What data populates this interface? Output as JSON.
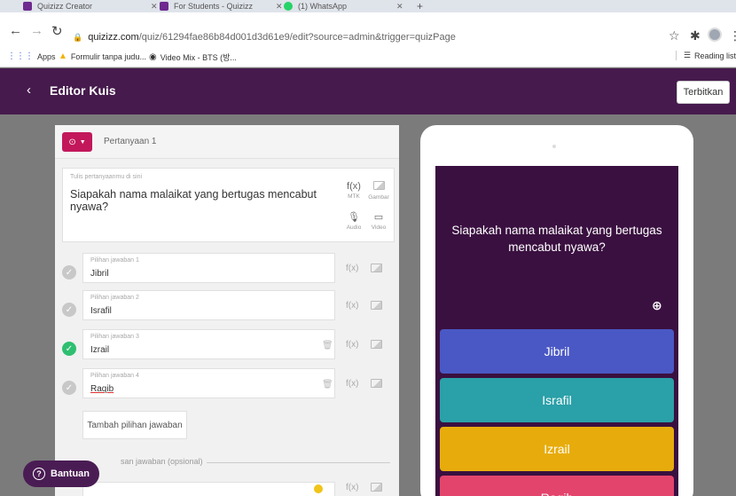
{
  "browser": {
    "tabs": [
      {
        "label": "Quizizz Creator"
      },
      {
        "label": "For Students - Quizizz"
      },
      {
        "label": "(1) WhatsApp"
      }
    ],
    "url_host": "quizizz.com",
    "url_path": "/quiz/61294fae86b84d001d3d61e9/edit?source=admin&trigger=quizPage",
    "bookmarks": [
      {
        "label": "Apps",
        "icon": "apps-grid-icon"
      },
      {
        "label": "Formulir tanpa judu...",
        "icon": "google-drive-icon"
      },
      {
        "label": "Video Mix - BTS (방...",
        "icon": "globe-icon"
      }
    ],
    "reading_list": "Reading list"
  },
  "header": {
    "title": "Editor Kuis",
    "publish_label": "Terbitkan",
    "color": "#461a4d"
  },
  "editor": {
    "question_number_label": "Pertanyaan 1",
    "question_placeholder": "Tulis pertanyaanmu di sini",
    "question_text": "Siapakah nama malaikat yang bertugas mencabut nyawa?",
    "tools": {
      "math_symbol": "f(x)",
      "math_label": "MTK",
      "image_label": "Gambar",
      "audio_label": "Audio",
      "video_label": "Video"
    },
    "answers": [
      {
        "label": "Pilihan jawaban 1",
        "value": "Jibril",
        "correct": false
      },
      {
        "label": "Pilihan jawaban 2",
        "value": "Israfil",
        "correct": false
      },
      {
        "label": "Pilihan jawaban 3",
        "value": "Izrail",
        "correct": true
      },
      {
        "label": "Pilihan jawaban 4",
        "value": "Raqib",
        "correct": false
      }
    ],
    "add_answer_label": "Tambah pilihan jawaban",
    "explanation_label": "san jawaban (opsional)"
  },
  "help": {
    "label": "Bantuan"
  },
  "preview": {
    "question_text": "Siapakah nama malaikat yang bertugas mencabut nyawa?",
    "options": [
      {
        "text": "Jibril",
        "color": "#4a58c5"
      },
      {
        "text": "Israfil",
        "color": "#2aa0a8"
      },
      {
        "text": "Izrail",
        "color": "#e7ac0c"
      },
      {
        "text": "Raqib",
        "color": "#e3446c"
      }
    ]
  }
}
